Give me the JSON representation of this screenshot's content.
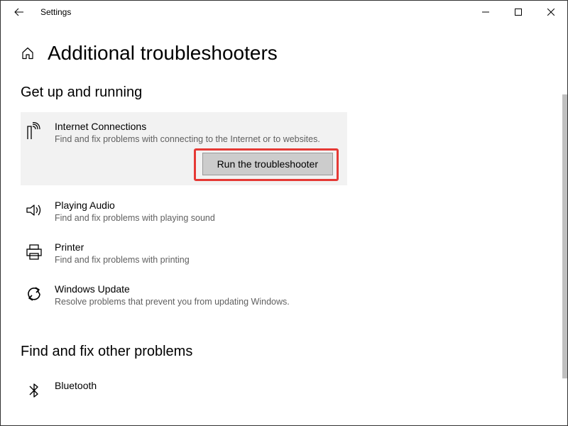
{
  "titlebar": {
    "title": "Settings"
  },
  "page": {
    "title": "Additional troubleshooters"
  },
  "sections": {
    "get_up_running": {
      "title": "Get up and running",
      "items": [
        {
          "title": "Internet Connections",
          "desc": "Find and fix problems with connecting to the Internet or to websites."
        },
        {
          "title": "Playing Audio",
          "desc": "Find and fix problems with playing sound"
        },
        {
          "title": "Printer",
          "desc": "Find and fix problems with printing"
        },
        {
          "title": "Windows Update",
          "desc": "Resolve problems that prevent you from updating Windows."
        }
      ]
    },
    "find_fix": {
      "title": "Find and fix other problems",
      "items": [
        {
          "title": "Bluetooth",
          "desc": ""
        }
      ]
    }
  },
  "buttons": {
    "run_troubleshooter": "Run the troubleshooter"
  }
}
